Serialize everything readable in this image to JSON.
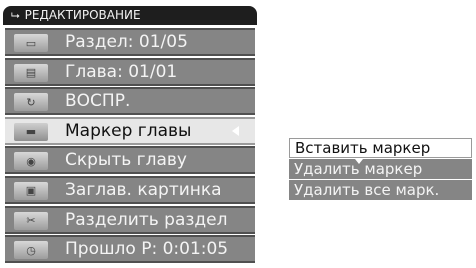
{
  "header": {
    "arrow": "⮡",
    "title": "РЕДАКТИРОВАНИЕ"
  },
  "menu": [
    {
      "icon": "section-icon",
      "label": "Раздел: 01/05"
    },
    {
      "icon": "chapter-icon",
      "label": "Глава: 01/01"
    },
    {
      "icon": "play-icon",
      "label": "ВОСПР."
    },
    {
      "icon": "chapter-marker-icon",
      "label": "Маркер главы",
      "selected": true
    },
    {
      "icon": "hide-chapter-icon",
      "label": "Скрыть главу"
    },
    {
      "icon": "title-picture-icon",
      "label": "Заглав. картинка"
    },
    {
      "icon": "split-section-icon",
      "label": "Разделить раздел"
    },
    {
      "icon": "elapsed-time-icon",
      "label": "Прошло  P: 0:01:05"
    }
  ],
  "submenu": [
    {
      "label": "Вставить маркер",
      "active": true
    },
    {
      "label": "Удалить маркер"
    },
    {
      "label": "Удалить все марк."
    }
  ]
}
